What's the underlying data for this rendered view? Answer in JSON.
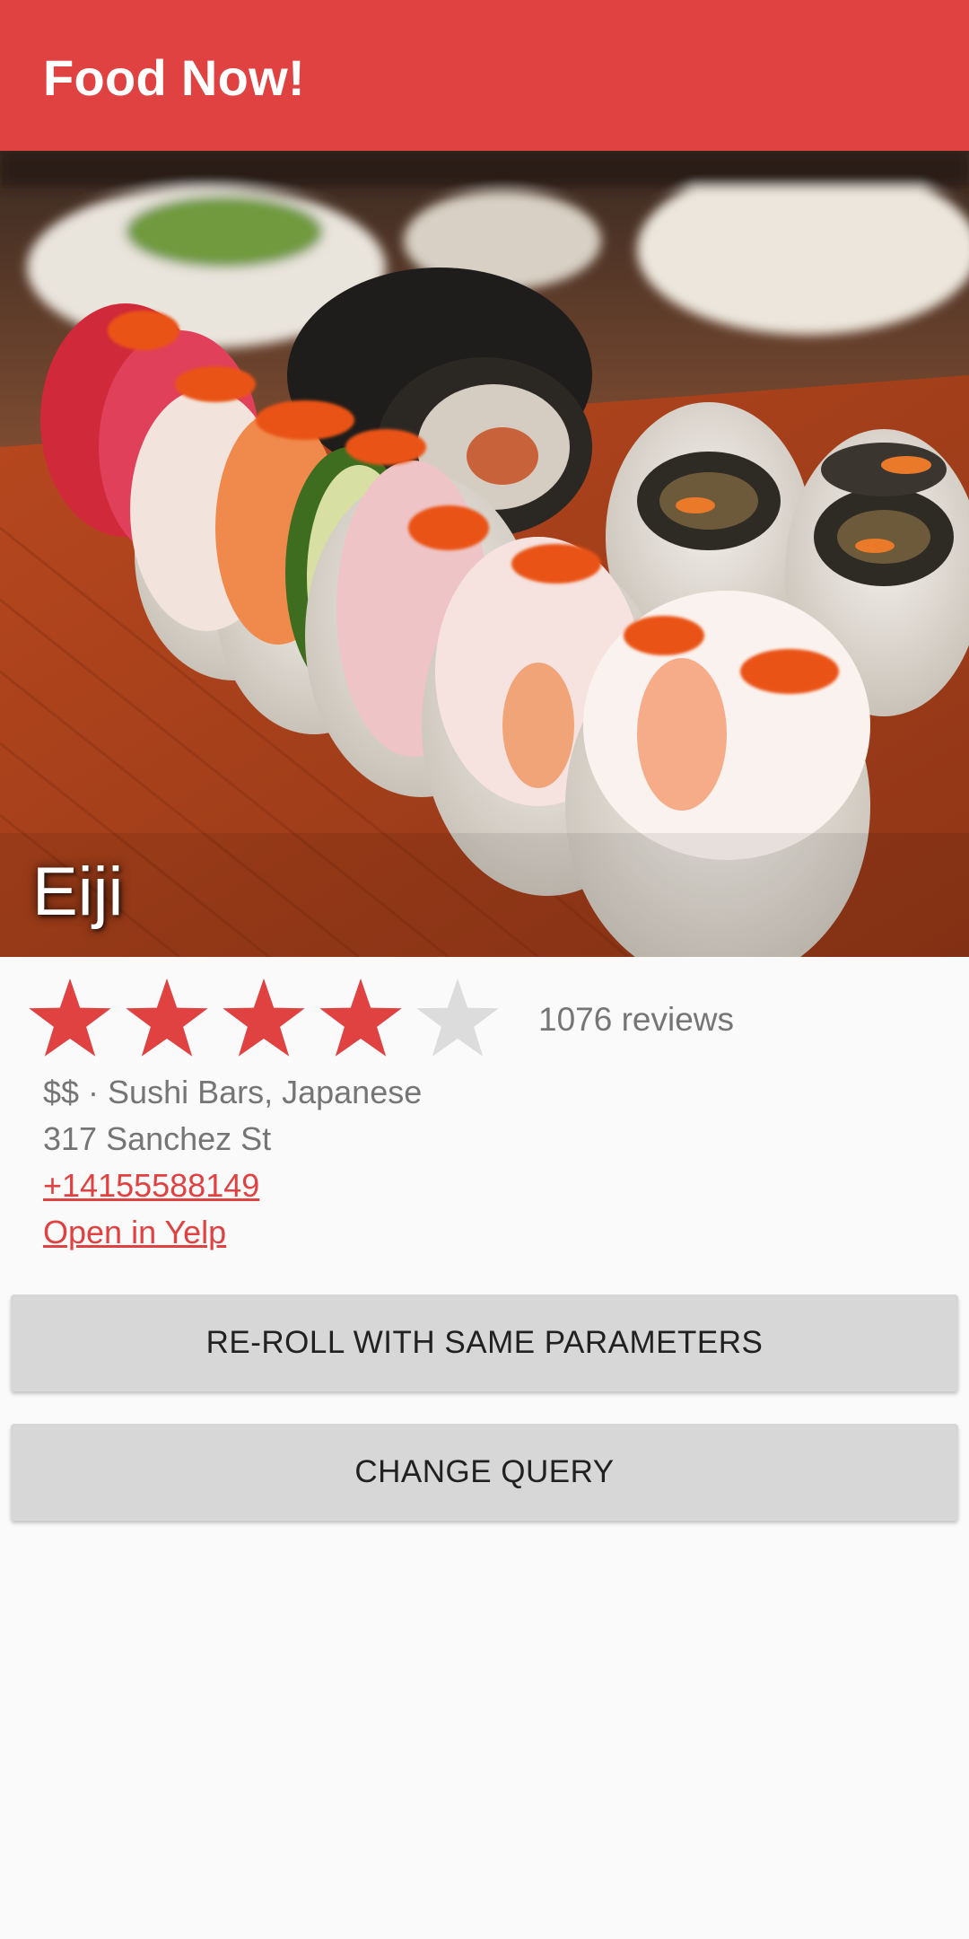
{
  "app_bar": {
    "title": "Food Now!",
    "color": "#e04141"
  },
  "restaurant": {
    "name": "Eiji",
    "photo_icon": "sushi-photo",
    "rating": 4,
    "rating_max": 5,
    "reviews": "1076 reviews",
    "price_categories": "$$ · Sushi Bars, Japanese",
    "address": "317 Sanchez St",
    "phone": "+14155588149",
    "yelp_link": "Open in Yelp"
  },
  "actions": {
    "reroll_label": "RE-ROLL WITH SAME PARAMETERS",
    "change_query_label": "CHANGE QUERY"
  },
  "colors": {
    "accent": "#e04141",
    "star_filled": "#e04141",
    "star_empty": "#dcdcdc",
    "secondary_text": "#757575",
    "button_bg": "#d7d7d7"
  }
}
